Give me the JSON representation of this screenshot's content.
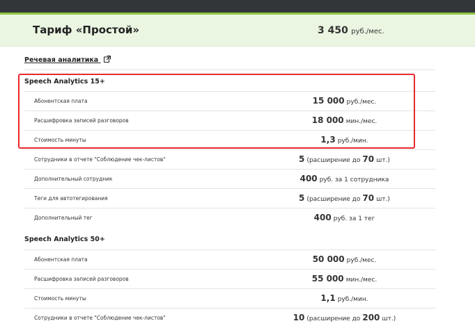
{
  "plan": {
    "name": "Тариф «Простой»",
    "price": "3 450",
    "price_unit": "руб./мес."
  },
  "section": {
    "title": "Речевая аналитика"
  },
  "groups": [
    {
      "title": "Speech Analytics 15+",
      "rows": [
        {
          "label": "Абонентская плата",
          "value": "15 000",
          "unit": "руб./мес.",
          "post": "",
          "post_num": "",
          "post_unit": ""
        },
        {
          "label": "Расшифровка записей разговоров",
          "value": "18 000",
          "unit": "мин./мес.",
          "post": "",
          "post_num": "",
          "post_unit": ""
        },
        {
          "label": "Стоимость минуты",
          "value": "1,3",
          "unit": "руб./мин.",
          "post": "",
          "post_num": "",
          "post_unit": ""
        },
        {
          "label": "Сотрудники в отчете \"Соблюдение чек-листов\"",
          "value": "5",
          "unit": "(расширение до",
          "post": "",
          "post_num": "70",
          "post_unit": "шт.)"
        },
        {
          "label": "Дополнительный сотрудник",
          "value": "400",
          "unit": "руб. за 1 сотрудника",
          "post": "",
          "post_num": "",
          "post_unit": ""
        },
        {
          "label": "Теги для автотегирования",
          "value": "5",
          "unit": "(расширение до",
          "post": "",
          "post_num": "70",
          "post_unit": "шт.)"
        },
        {
          "label": "Дополнительный тег",
          "value": "400",
          "unit": "руб. за 1 тег",
          "post": "",
          "post_num": "",
          "post_unit": ""
        }
      ]
    },
    {
      "title": "Speech Analytics 50+",
      "rows": [
        {
          "label": "Абонентская плата",
          "value": "50 000",
          "unit": "руб./мес.",
          "post": "",
          "post_num": "",
          "post_unit": ""
        },
        {
          "label": "Расшифровка записей разговоров",
          "value": "55 000",
          "unit": "мин./мес.",
          "post": "",
          "post_num": "",
          "post_unit": ""
        },
        {
          "label": "Стоимость минуты",
          "value": "1,1",
          "unit": "руб./мин.",
          "post": "",
          "post_num": "",
          "post_unit": ""
        },
        {
          "label": "Сотрудники в отчете \"Соблюдение чек-листов\"",
          "value": "10",
          "unit": "(расширение до",
          "post": "",
          "post_num": "200",
          "post_unit": "шт.)"
        }
      ]
    }
  ],
  "colors": {
    "highlight": "#e8282b",
    "header_bg": "#eaf6e2",
    "accent": "#8cc63f"
  }
}
